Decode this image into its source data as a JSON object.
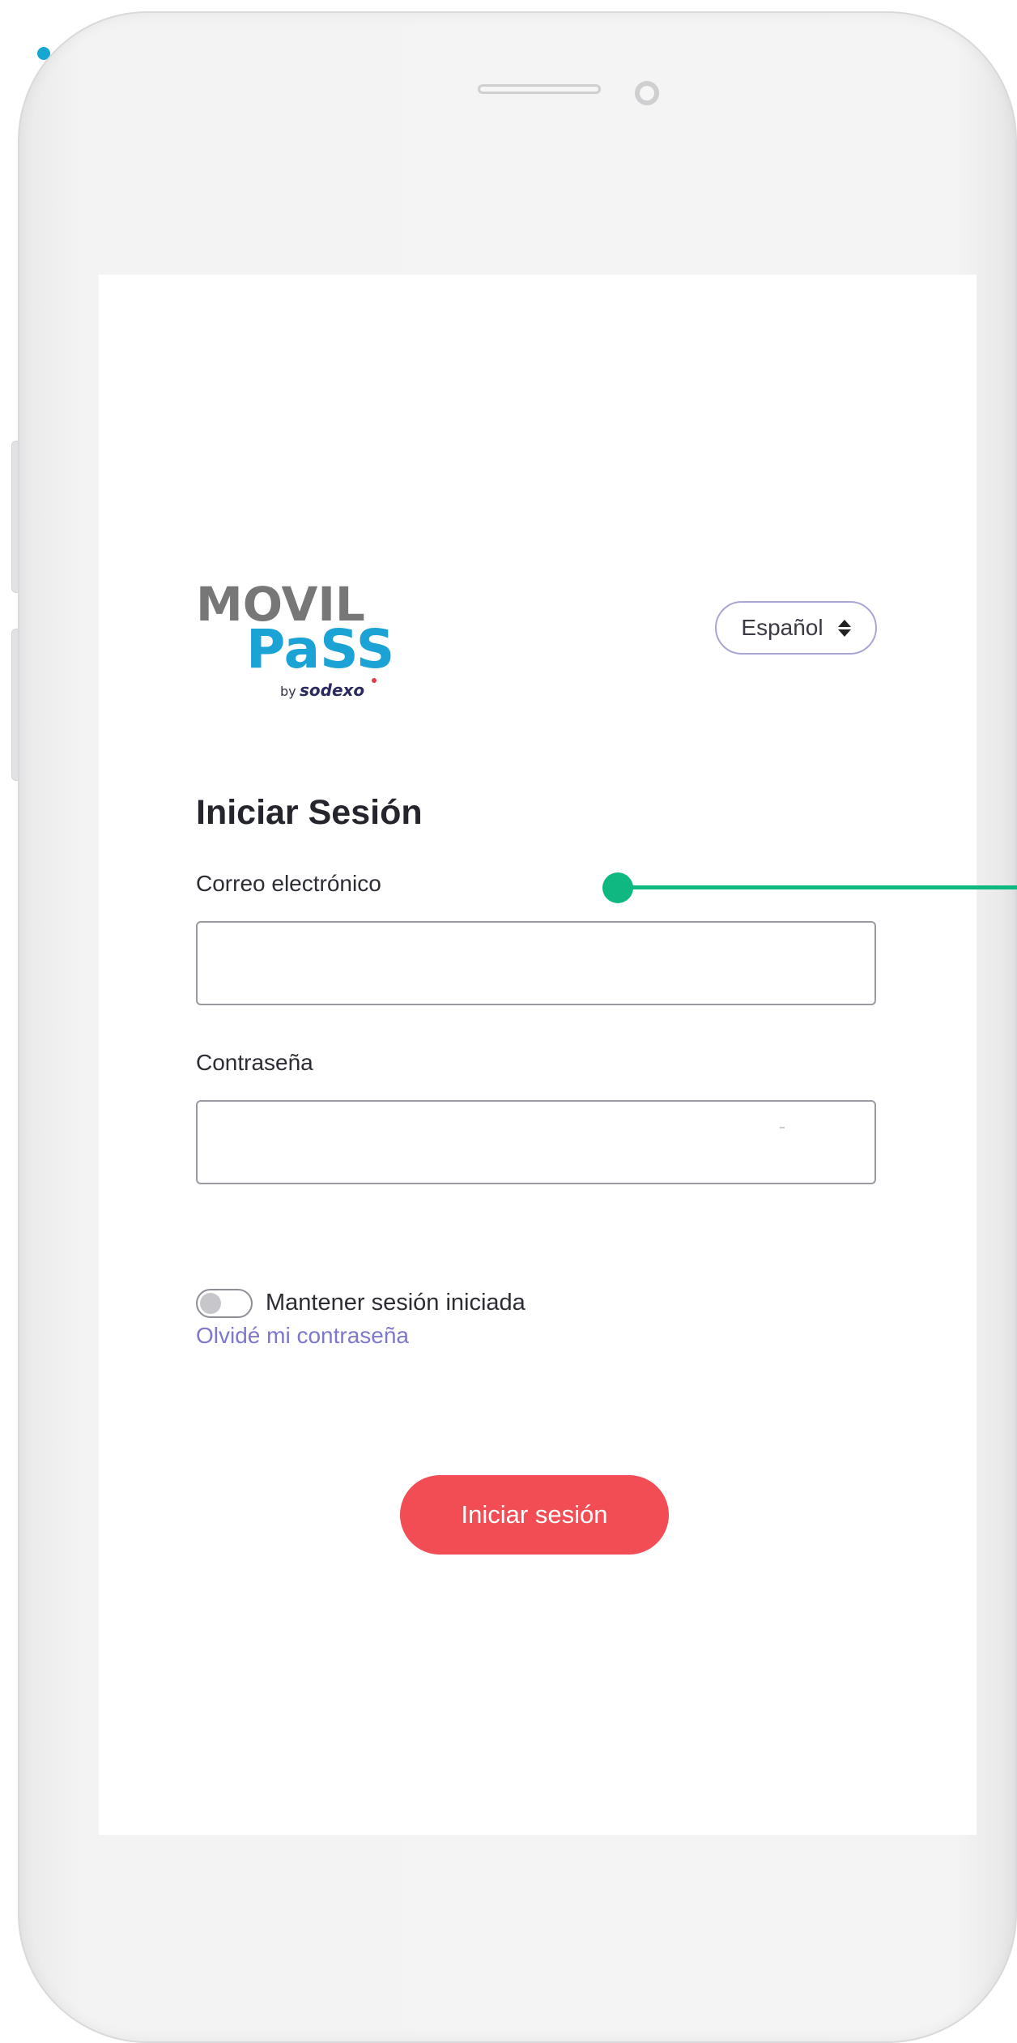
{
  "app": {
    "logo": {
      "line1": "MOVIL",
      "line2": "PaSS",
      "byline": "by",
      "brand": "sodexo"
    },
    "language_select": {
      "value": "Español",
      "icon": "sort-arrows-icon"
    }
  },
  "login": {
    "title": "Iniciar Sesión",
    "email_label": "Correo electrónico",
    "email_value": "",
    "password_label": "Contraseña",
    "password_value": "",
    "keep_session_label": "Mantener sesión iniciada",
    "keep_session_on": false,
    "forgot_password_link": "Olvidé mi contraseña",
    "submit_label": "Iniciar sesión"
  },
  "colors": {
    "accent_red": "#f24c55",
    "link_purple": "#7d78c9",
    "logo_blue": "#1ba3d6",
    "logo_gray": "#777777",
    "pointer_green": "#0fb880"
  }
}
